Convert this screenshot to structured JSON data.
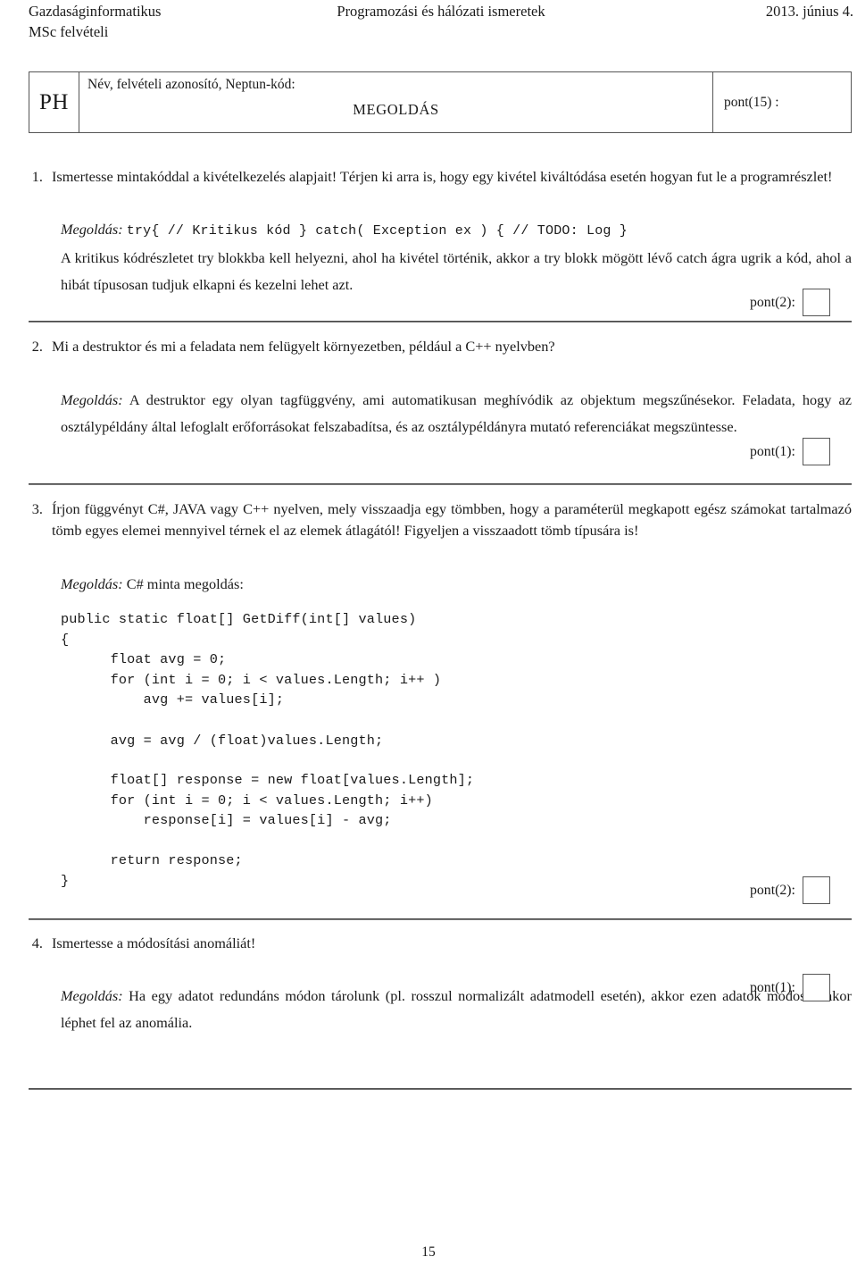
{
  "header": {
    "left_line1": "Gazdaságinformatikus",
    "left_line2": "MSc felvételi",
    "center": "Programozási és hálózati ismeretek",
    "right": "2013. június 4."
  },
  "id_table": {
    "subject_code": "PH",
    "name_label": "Név, felvételi azonosító, Neptun-kód:",
    "name_value": "MEGOLDÁS",
    "total_points_label": "pont(15) :"
  },
  "questions": [
    {
      "number": "1.",
      "prompt": "Ismertesse mintakóddal a kivételkezelés alapjait! Térjen ki arra is, hogy egy kivétel kiváltódása esetén hogyan fut le a programrészlet!",
      "solution_label": "Megoldás:",
      "solution_code": "try{ // Kritikus kód } catch( Exception ex ) { // TODO: Log }",
      "solution_text": "A kritikus kódrészletet try blokkba kell helyezni, ahol ha kivétel történik, akkor a try blokk mögött lévő catch ágra ugrik a kód, ahol a hibát típusosan tudjuk elkapni és kezelni lehet azt.",
      "point_label": "pont(2):"
    },
    {
      "number": "2.",
      "prompt": "Mi a destruktor és mi a feladata nem felügyelt környezetben, például a C++ nyelvben?",
      "solution_label": "Megoldás:",
      "solution_text": "A destruktor egy olyan tagfüggvény, ami automatikusan meghívódik az objektum megszűnésekor. Feladata, hogy az osztálypéldány által lefoglalt erőforrásokat felszabadítsa, és az osztálypéldányra mutató referenciákat megszüntesse.",
      "point_label": "pont(1):"
    },
    {
      "number": "3.",
      "prompt": "Írjon függvényt C#, JAVA vagy C++ nyelven, mely visszaadja egy tömbben, hogy a paraméterül megkapott egész számokat tartalmazó tömb egyes elemei mennyivel térnek el az elemek átlagától! Figyeljen a visszaadott tömb típusára is!",
      "solution_label": "Megoldás:",
      "solution_text": "C# minta megoldás:",
      "code_block_1": "public static float[] GetDiff(int[] values)\n{\n      float avg = 0;\n      for (int i = 0; i < values.Length; i++ )\n          avg += values[i];\n\n      avg = avg / (float)values.Length;",
      "code_block_2": "      float[] response = new float[values.Length];\n      for (int i = 0; i < values.Length; i++)\n          response[i] = values[i] - avg;\n\n      return response;\n}",
      "point_label": "pont(2):"
    },
    {
      "number": "4.",
      "prompt": "Ismertesse a módosítási anomáliát!",
      "solution_label": "Megoldás:",
      "solution_text": "Ha egy adatot redundáns módon tárolunk (pl. rosszul normalizált adatmodell esetén), akkor ezen adatok módosításakor léphet fel az anomália.",
      "point_label": "pont(1):"
    }
  ],
  "footer": {
    "page_number": "15"
  }
}
